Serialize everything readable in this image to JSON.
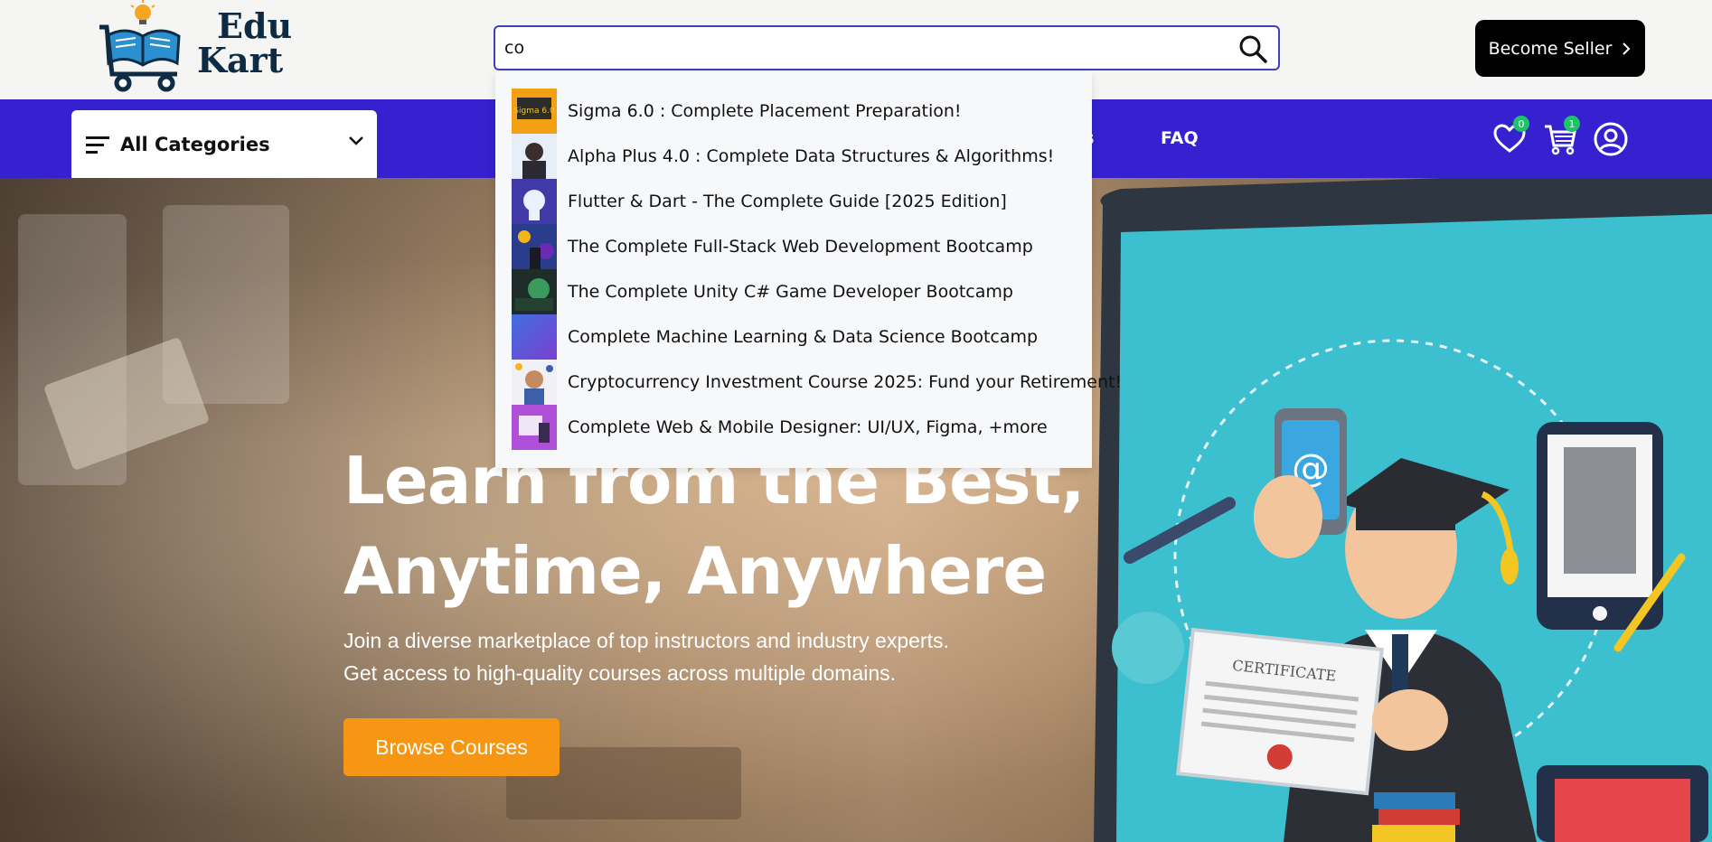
{
  "brand": {
    "line1": "Edu",
    "line2": "Kart"
  },
  "search": {
    "value": "co",
    "placeholder": ""
  },
  "header": {
    "seller_label": "Become Seller"
  },
  "nav": {
    "categories_label": "All Categories",
    "links": [
      {
        "label": "ts"
      },
      {
        "label": "FAQ"
      }
    ],
    "wishlist_count": "0",
    "cart_count": "1"
  },
  "dropdown": {
    "items": [
      {
        "label": "Sigma 6.0 : Complete Placement Preparation!",
        "thumb_text": "Sigma 6.0"
      },
      {
        "label": "Alpha Plus 4.0 : Complete Data Structures & Algorithms!"
      },
      {
        "label": "Flutter & Dart - The Complete Guide [2025 Edition]"
      },
      {
        "label": "The Complete Full-Stack Web Development Bootcamp"
      },
      {
        "label": "The Complete Unity C# Game Developer Bootcamp"
      },
      {
        "label": "Complete Machine Learning & Data Science Bootcamp"
      },
      {
        "label": "Cryptocurrency Investment Course 2025: Fund your Retirement!"
      },
      {
        "label": "Complete Web & Mobile Designer: UI/UX, Figma, +more"
      }
    ]
  },
  "hero": {
    "title_line1": "Learn from the Best,",
    "title_line2": "Anytime, Anywhere",
    "sub_line1": "Join a diverse marketplace of top instructors and industry experts.",
    "sub_line2": "Get access to high-quality courses across multiple domains.",
    "button_label": "Browse Courses",
    "illustration_text": "CERTIFICATE"
  },
  "colors": {
    "nav_bg": "#3521cf",
    "accent_orange": "#f79612",
    "badge_green": "#1fc266",
    "search_border": "#3f3fbf"
  }
}
